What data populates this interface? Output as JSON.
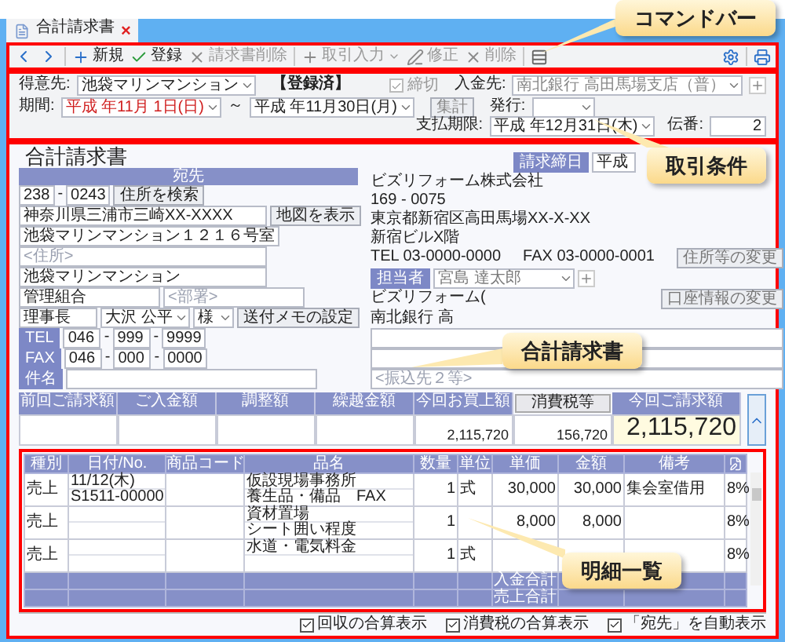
{
  "tab": {
    "title": "合計請求書",
    "close": "×"
  },
  "toolbar": {
    "items": [
      {
        "kind": "add",
        "label": "新規",
        "disabled": false,
        "dropdown": false
      },
      {
        "kind": "check",
        "label": "登録",
        "disabled": false,
        "dropdown": false
      },
      {
        "kind": "cross",
        "label": "請求書削除",
        "disabled": true,
        "dropdown": false
      },
      {
        "kind": "add",
        "label": "取引入力",
        "disabled": true,
        "dropdown": true
      },
      {
        "kind": "edit",
        "label": "修正",
        "disabled": true,
        "dropdown": false
      },
      {
        "kind": "cross",
        "label": "削除",
        "disabled": true,
        "dropdown": false
      }
    ]
  },
  "conditions": {
    "customer_label": "得意先:",
    "customer": "池袋マリンマンション",
    "status": "【登録済】",
    "closing": {
      "label": "締切",
      "checked": true,
      "disabled": true
    },
    "deposit_label": "入金先:",
    "deposit": "南北銀行 高田馬場支店（普）",
    "period_label": "期間:",
    "period_from": "平成 年11月 1日(日)",
    "tilde": "～",
    "period_to": "平成 年11月30日(月)",
    "total_button": "集計",
    "issue_label": "発行:",
    "due_label": "支払期限:",
    "due": "平成 年12月31日(木)",
    "slip_label": "伝番:",
    "slip": "2"
  },
  "invoice": {
    "title": "合計請求書",
    "recipient": {
      "header": "宛先",
      "zip1": "238",
      "zip_sep": "-",
      "zip2": "0243",
      "search_button": "住所を検索",
      "address1": "神奈川県三浦市三崎XX-XXXX",
      "map_button": "地図を表示",
      "address2": "池袋マリンマンション１２１６号室",
      "address3_placeholder": "<住所>",
      "name1": "池袋マリンマンション",
      "name2": "管理組合",
      "dept_placeholder": "<部署>",
      "position": "理事長",
      "person": "大沢 公平",
      "honorific": "様",
      "memo_button": "送付メモの設定",
      "tel_label": "TEL",
      "tel": [
        "046",
        "999",
        "9999"
      ],
      "tel_separators": [
        "-",
        "-"
      ],
      "fax_label": "FAX",
      "fax": [
        "046",
        "000",
        "0000"
      ],
      "fax_separators": [
        "-",
        "-"
      ],
      "subject_label": "件名"
    },
    "issuer": {
      "closing_label": "請求締日",
      "closing_date": "平成",
      "company": "ビズリフォーム株式会社",
      "zip": "169 - 0075",
      "address1": "東京都新宿区高田馬場XX-X-XX",
      "address2": "新宿ビルX階",
      "tel": "TEL 03-0000-0000",
      "fax": "FAX 03-0000-0001",
      "address_button": "住所等の変更",
      "staff_label": "担当者",
      "staff": "宮島 達太郎",
      "payee": "ビズリフォーム(",
      "account_button": "口座情報の変更",
      "bank": "南北銀行 高",
      "transfer_placeholders": [
        "<振込先２等>"
      ]
    },
    "summary": [
      {
        "header": "前回ご請求額"
      },
      {
        "header": "ご入金額"
      },
      {
        "header": "調整額"
      },
      {
        "header": "繰越金額"
      },
      {
        "header": "今回お買上額",
        "value": "2,115,720"
      },
      {
        "header": "消費税等",
        "kind": "button",
        "value": "156,720"
      },
      {
        "header": "今回ご請求額",
        "kind": "total",
        "value": "2,115,720"
      }
    ]
  },
  "details": {
    "columns": [
      "種別",
      "日付/No.",
      "商品コード",
      "品名",
      "数量",
      "単位",
      "単価",
      "金額",
      "備考"
    ],
    "rows": [
      {
        "type": "売上",
        "date": "11/12(木)",
        "no": "S1511-00000",
        "items": [
          "仮設現場事務所",
          "養生品・備品　FAX"
        ],
        "qty": "1",
        "unit": "式",
        "price": "30,000",
        "amount": "30,000",
        "note": "集会室借用",
        "tax": "8%"
      },
      {
        "type": "売上",
        "items": [
          "資材置場",
          "シート囲い程度"
        ],
        "qty": "1",
        "price": "8,000",
        "amount": "8,000",
        "tax": "8%"
      },
      {
        "type": "売上",
        "items": [
          "水道・電気料金"
        ],
        "qty": "1",
        "unit": "式",
        "tax": "8%"
      }
    ],
    "totals": [
      "入金合計",
      "売上合計"
    ]
  },
  "footer": [
    {
      "label": "回収の合算表示",
      "checked": true
    },
    {
      "label": "消費税の合算表示",
      "checked": true
    },
    {
      "label": "「宛先」を自動表示",
      "checked": true
    }
  ],
  "callouts": [
    "コマンドバー",
    "取引条件",
    "合計請求書",
    "明細一覧"
  ]
}
